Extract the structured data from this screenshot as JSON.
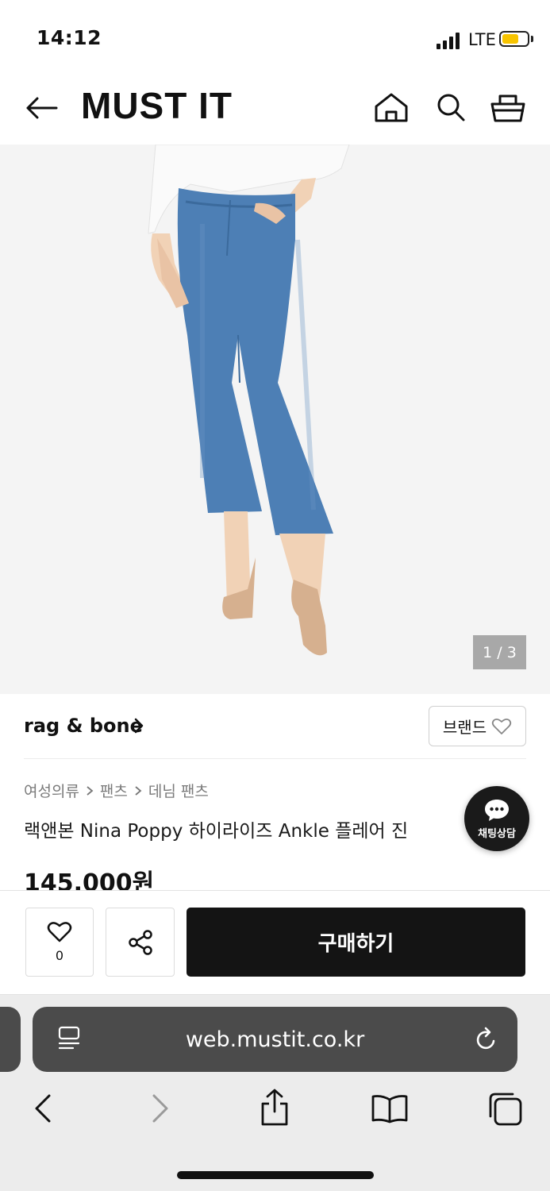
{
  "status": {
    "time": "14:12",
    "network": "LTE"
  },
  "header": {
    "logo": "MUST IT"
  },
  "gallery": {
    "counter": "1 / 3"
  },
  "brand": {
    "name": "rag & bone",
    "follow_label": "브랜드"
  },
  "breadcrumb": [
    "여성의류",
    "팬츠",
    "데님 팬츠"
  ],
  "product": {
    "title": "랙앤본 Nina Poppy 하이라이즈 Ankle 플레어 진",
    "price": "145,000원"
  },
  "chat": {
    "label": "채팅상담"
  },
  "actions": {
    "wish_count": "0",
    "buy_label": "구매하기"
  },
  "browser": {
    "url": "web.mustit.co.kr"
  },
  "colors": {
    "accent_dark": "#141414",
    "battery": "#f7c400",
    "denim": "#4d7fb5"
  }
}
